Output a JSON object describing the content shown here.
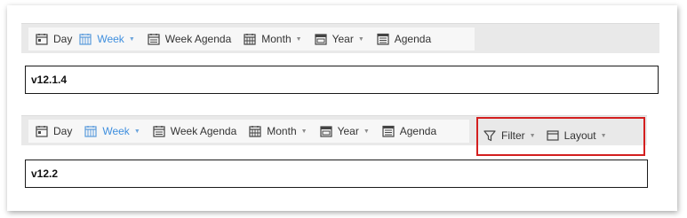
{
  "panels": [
    {
      "version": "v12.1.4",
      "views": [
        {
          "label": "Day",
          "icon": "calendar-day-icon",
          "dropdown": false,
          "active": false
        },
        {
          "label": "Week",
          "icon": "calendar-week-icon",
          "dropdown": true,
          "active": true
        },
        {
          "label": "Week Agenda",
          "icon": "calendar-week-agenda-icon",
          "dropdown": false,
          "active": false
        },
        {
          "label": "Month",
          "icon": "calendar-month-icon",
          "dropdown": true,
          "active": false
        },
        {
          "label": "Year",
          "icon": "calendar-year-icon",
          "dropdown": true,
          "active": false
        },
        {
          "label": "Agenda",
          "icon": "agenda-list-icon",
          "dropdown": false,
          "active": false
        }
      ]
    },
    {
      "version": "v12.2",
      "views": [
        {
          "label": "Day",
          "icon": "calendar-day-icon",
          "dropdown": false,
          "active": false
        },
        {
          "label": "Week",
          "icon": "calendar-week-icon",
          "dropdown": true,
          "active": true
        },
        {
          "label": "Week Agenda",
          "icon": "calendar-week-agenda-icon",
          "dropdown": false,
          "active": false
        },
        {
          "label": "Month",
          "icon": "calendar-month-icon",
          "dropdown": true,
          "active": false
        },
        {
          "label": "Year",
          "icon": "calendar-year-icon",
          "dropdown": true,
          "active": false
        },
        {
          "label": "Agenda",
          "icon": "agenda-list-icon",
          "dropdown": false,
          "active": false
        }
      ],
      "extra_tools": [
        {
          "label": "Filter",
          "icon": "filter-funnel-icon",
          "dropdown": true
        },
        {
          "label": "Layout",
          "icon": "layout-panel-icon",
          "dropdown": true
        }
      ]
    }
  ],
  "colors": {
    "active_text": "#3f8fde",
    "highlight_border": "#d31f1f",
    "toolbar_bg": "#e9e9e9"
  }
}
